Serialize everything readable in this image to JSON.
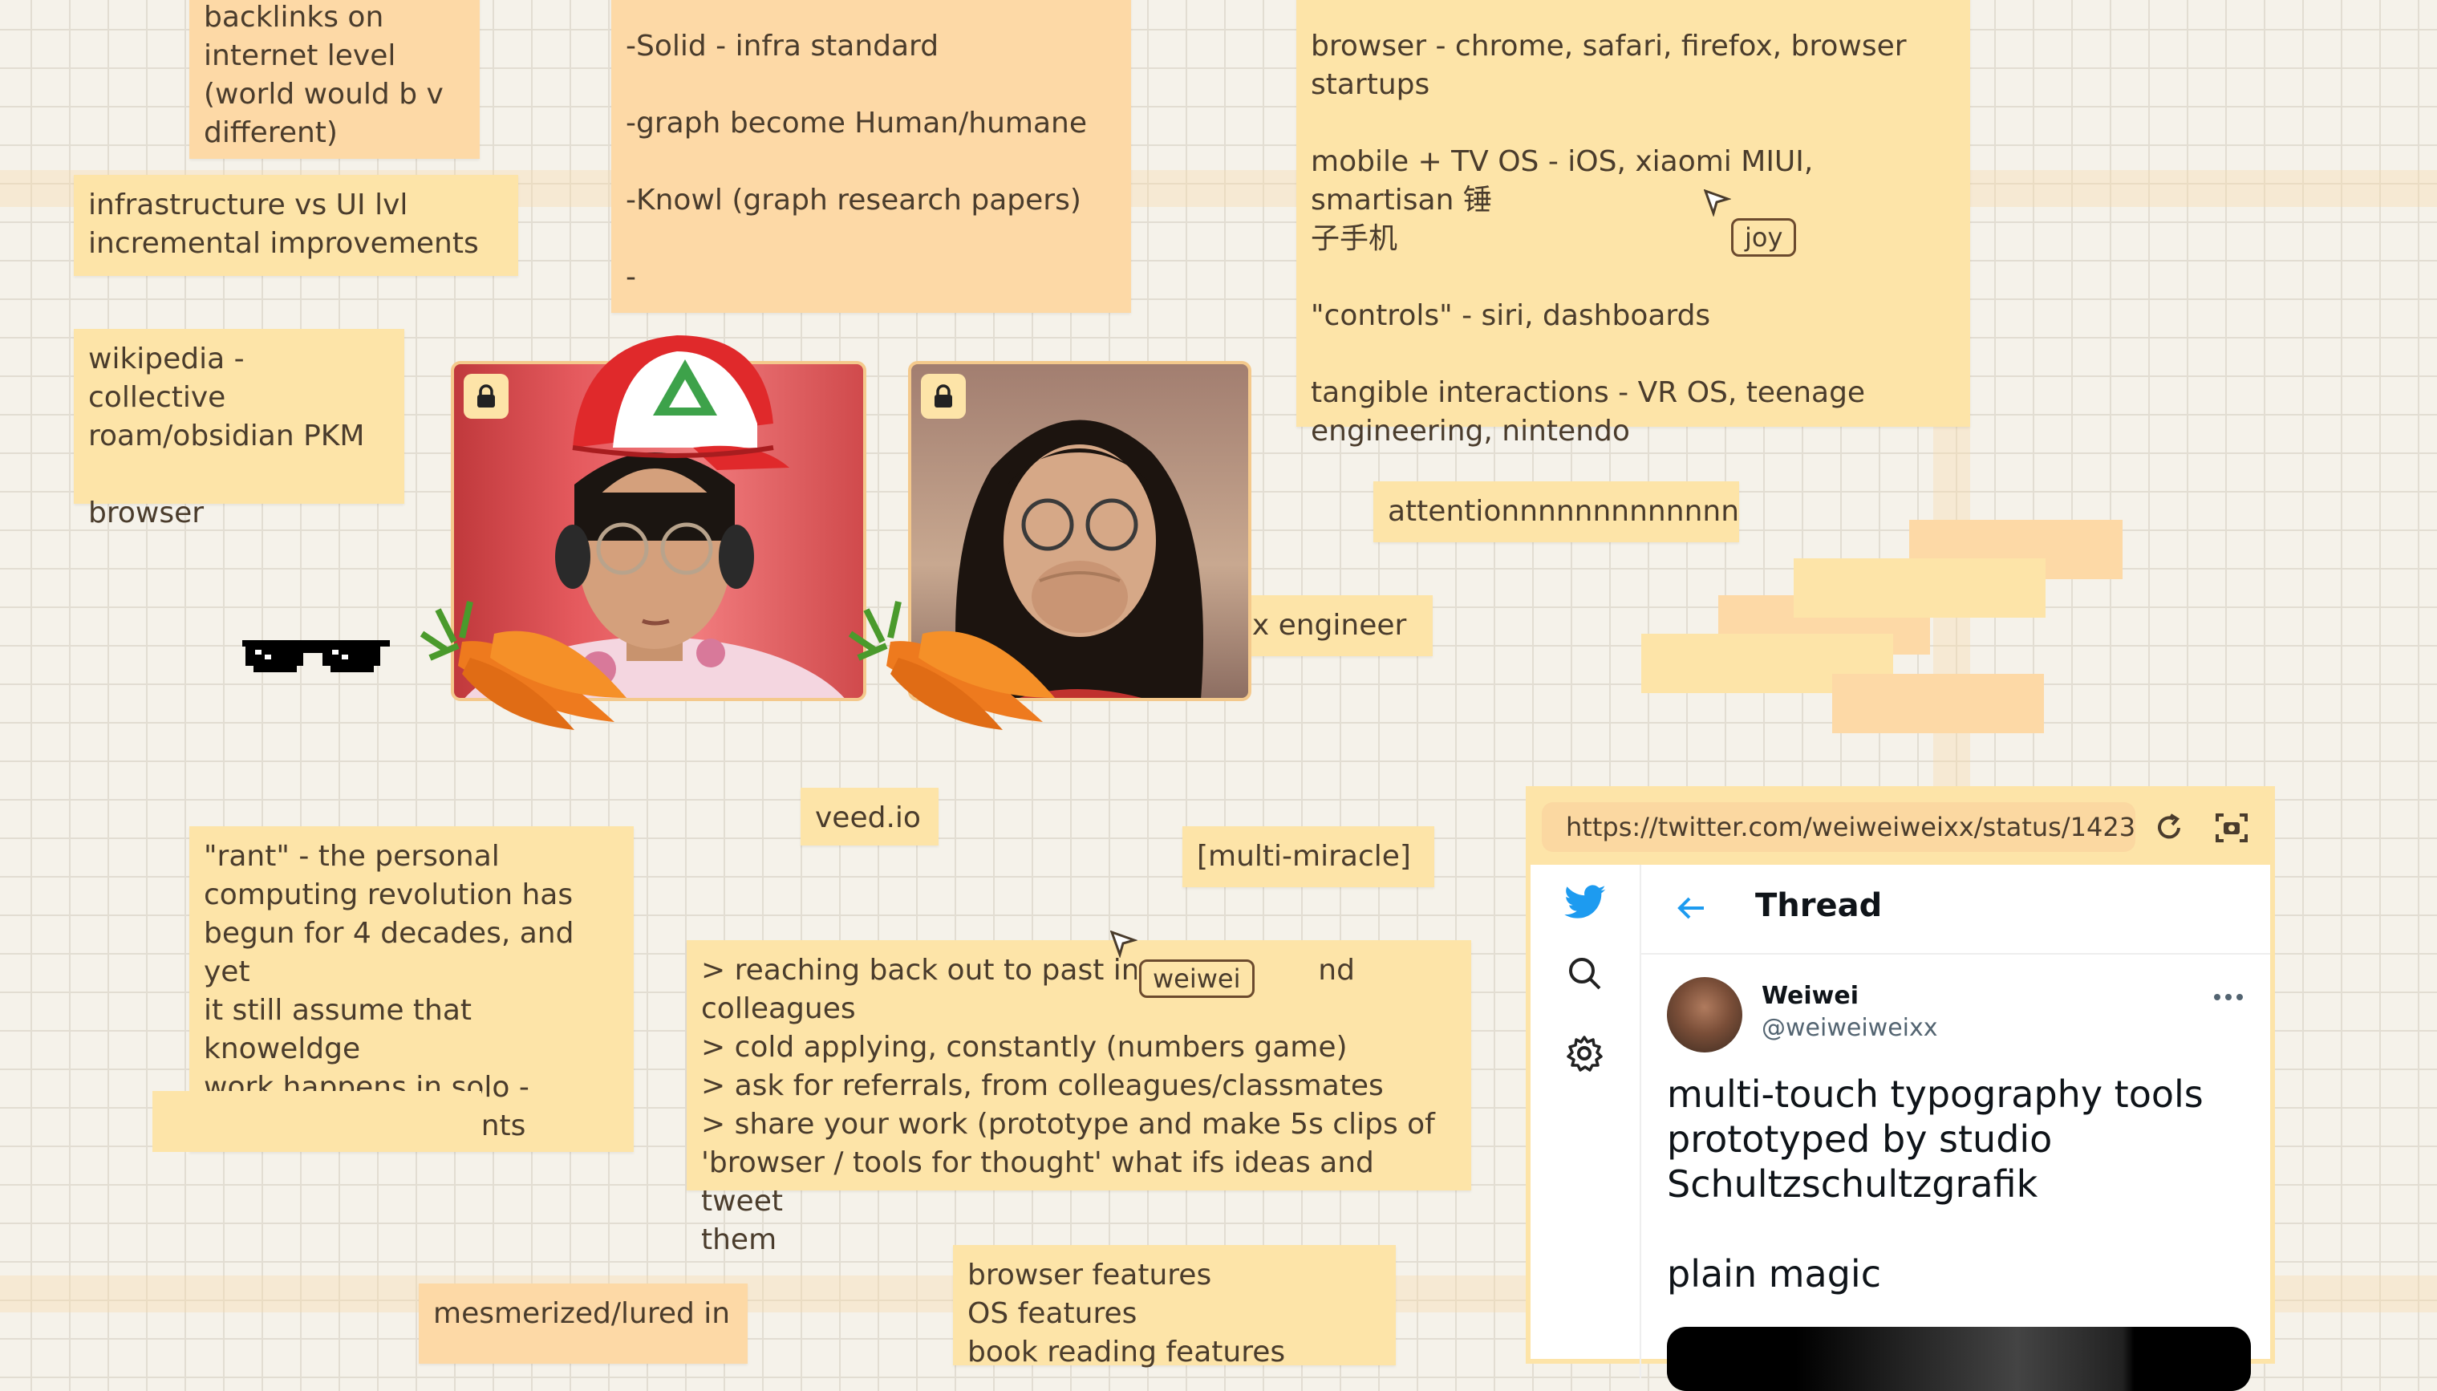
{
  "notes": {
    "backlinks": "backlinks on\ninternet level\n(world would b v\ndifferent)",
    "infra_ui": "infrastructure vs UI lvl\nincremental improvements",
    "wikipedia": "wikipedia - collective\nroam/obsidian PKM\n\nbrowser",
    "solid": "-Solid - infra standard\n\n-graph become Human/humane\n\n-Knowl (graph research papers)\n\n-",
    "browser_os": "browser - chrome, safari, firefox, browser\nstartups\n\nmobile + TV OS - iOS, xiaomi MIUI, smartisan 锤\n子手机\n\n\"controls\" - siri, dashboards\n\ntangible interactions - VR OS, teenage\nengineering, nintendo",
    "attention": "attentionnnnnnnnnnnnn",
    "ux_engineer": "ux engineer",
    "veed": "veed.io",
    "multi_miracle": "[multi-miracle]",
    "rant": "\"rant\" - the personal\ncomputing revolution has\nbegun for 4 decades, and yet\nit still assume that knoweldge\nwork happens in solo -\nisolated environments",
    "reaching": "> reaching back out to past inter               nd colleagues\n> cold applying, constantly (numbers game)\n> ask for referrals, from colleagues/classmates\n> share your work (prototype and make 5s clips of\n'browser / tools for thought' what ifs ideas and tweet\nthem",
    "mesmerized": "mesmerized/lured in",
    "features": "browser features\nOS features\nbook reading features"
  },
  "cursors": [
    {
      "name": "joy"
    },
    {
      "name": "weiwei"
    }
  ],
  "icons": [
    "lock-icon",
    "sunglasses-icon",
    "carrot-icon",
    "cap-icon",
    "twitter-bird-icon",
    "search-icon",
    "gear-icon",
    "back-arrow-icon",
    "refresh-icon",
    "screenshot-icon",
    "more-icon"
  ],
  "browser": {
    "url": "https://twitter.com/weiweiweixx/status/1423:",
    "header_title": "Thread",
    "author_name": "Weiwei",
    "author_handle": "@weiweiweixx",
    "tweet_text": "multi-touch typography tools\nprototyped by studio\nSchultzschultzgrafik",
    "tweet_text_2": "plain magic",
    "accent_color": "#1d9bf0"
  },
  "colors": {
    "note_yellow": "#fde4a8",
    "note_orange": "#fdd9a6",
    "canvas_bg": "#f5f2ea"
  }
}
